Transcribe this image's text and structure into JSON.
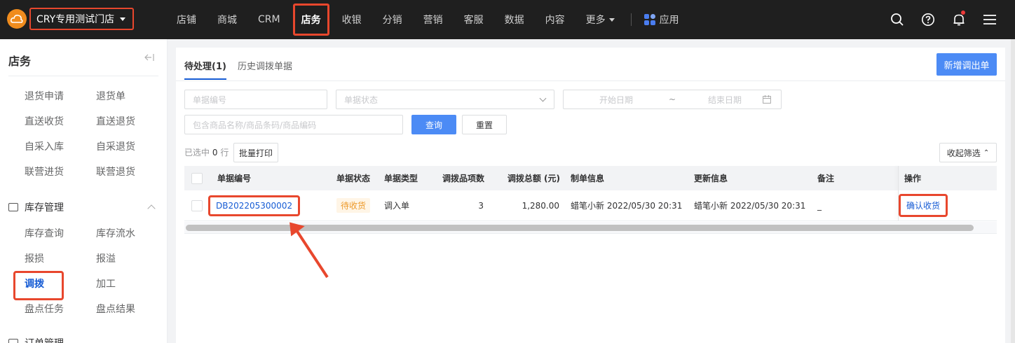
{
  "header": {
    "store_name": "CRY专用测试门店",
    "nav": [
      "店铺",
      "商城",
      "CRM",
      "店务",
      "收银",
      "分销",
      "营销",
      "客服",
      "数据",
      "内容",
      "更多"
    ],
    "active_nav": "店务",
    "apps_label": "应用",
    "icons": [
      "search-icon",
      "help-icon",
      "bell-icon",
      "menu-icon"
    ]
  },
  "sidebar": {
    "title": "店务",
    "items_top": [
      "退货申请",
      "退货单",
      "直送收货",
      "直送退货",
      "自采入库",
      "自采退货",
      "联营进货",
      "联营退货"
    ],
    "inventory_group": "库存管理",
    "items_inventory": [
      "库存查询",
      "库存流水",
      "报损",
      "报溢",
      "调拨",
      "加工",
      "盘点任务",
      "盘点结果"
    ],
    "next_group": "订单管理"
  },
  "main": {
    "tabs": [
      "待处理(1)",
      "历史调拨单据"
    ],
    "new_button": "新增调出单",
    "filters": {
      "doc_no_placeholder": "单据编号",
      "status_placeholder": "单据状态",
      "start_date_placeholder": "开始日期",
      "date_sep": "~",
      "end_date_placeholder": "结束日期",
      "goods_placeholder": "包含商品名称/商品条码/商品编码",
      "query_button": "查询",
      "reset_button": "重置"
    },
    "selected_prefix": "已选中",
    "selected_count": "0",
    "selected_suffix": "行",
    "batch_print": "批量打印",
    "collapse_filter": "收起筛选",
    "table": {
      "columns": [
        "单据编号",
        "单据状态",
        "单据类型",
        "调拨品项数",
        "调拨总额 (元)",
        "制单信息",
        "更新信息",
        "备注",
        "操作"
      ],
      "rows": [
        {
          "doc_no": "DB202205300002",
          "status": "待收货",
          "type": "调入单",
          "items": "3",
          "amount": "1,280.00",
          "created": "蜡笔小新 2022/05/30 20:31",
          "updated": "蜡笔小新 2022/05/30 20:31",
          "remark": "_",
          "action": "确认收货"
        }
      ]
    }
  },
  "colors": {
    "accent": "#155bd4",
    "highlight": "#e8472d",
    "primary_button": "#4c8bf5",
    "topbar": "#1f1f1f"
  }
}
